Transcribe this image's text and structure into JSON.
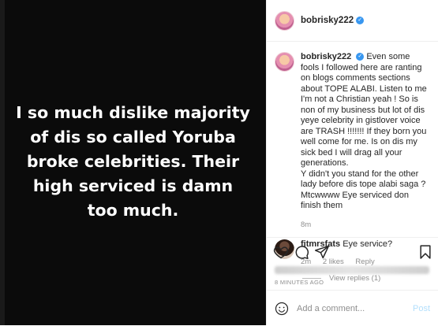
{
  "post": {
    "image_text": "I so much dislike majority\nof dis so called Yoruba\nbroke celebrities. Their\nhigh serviced is damn\ntoo much.",
    "author": "bobrisky222",
    "verified_mark": "✓"
  },
  "caption": {
    "author": "bobrisky222",
    "text": "Even some fools I followed here are ranting on blogs comments sections about TOPE ALABI. Listen to me I'm not a Christian yeah ! So is non of my business but lot of dis yeye celebrity in gistlover voice are TRASH !!!!!!! If they born you well come for me. Is on dis my sick bed I will drag all your generations.\nY didn't you stand for the other lady before dis tope alabi saga ? Mtcwwww Eye serviced don finish them",
    "time": "8m"
  },
  "comment": {
    "author": "fitmrsfats",
    "text": "Eye service?",
    "time": "2m",
    "likes": "2 likes",
    "reply": "Reply",
    "view_replies": "View replies (1)"
  },
  "footer": {
    "time_ago": "8 MINUTES AGO",
    "add_comment_placeholder": "Add a comment...",
    "post_button": "Post"
  },
  "colors": {
    "accent": "#3897f0",
    "post_button_disabled": "#b2dffc",
    "muted": "#8e8e8e"
  },
  "icons": [
    "heart-icon",
    "comment-icon",
    "share-icon",
    "bookmark-icon",
    "smiley-icon"
  ]
}
